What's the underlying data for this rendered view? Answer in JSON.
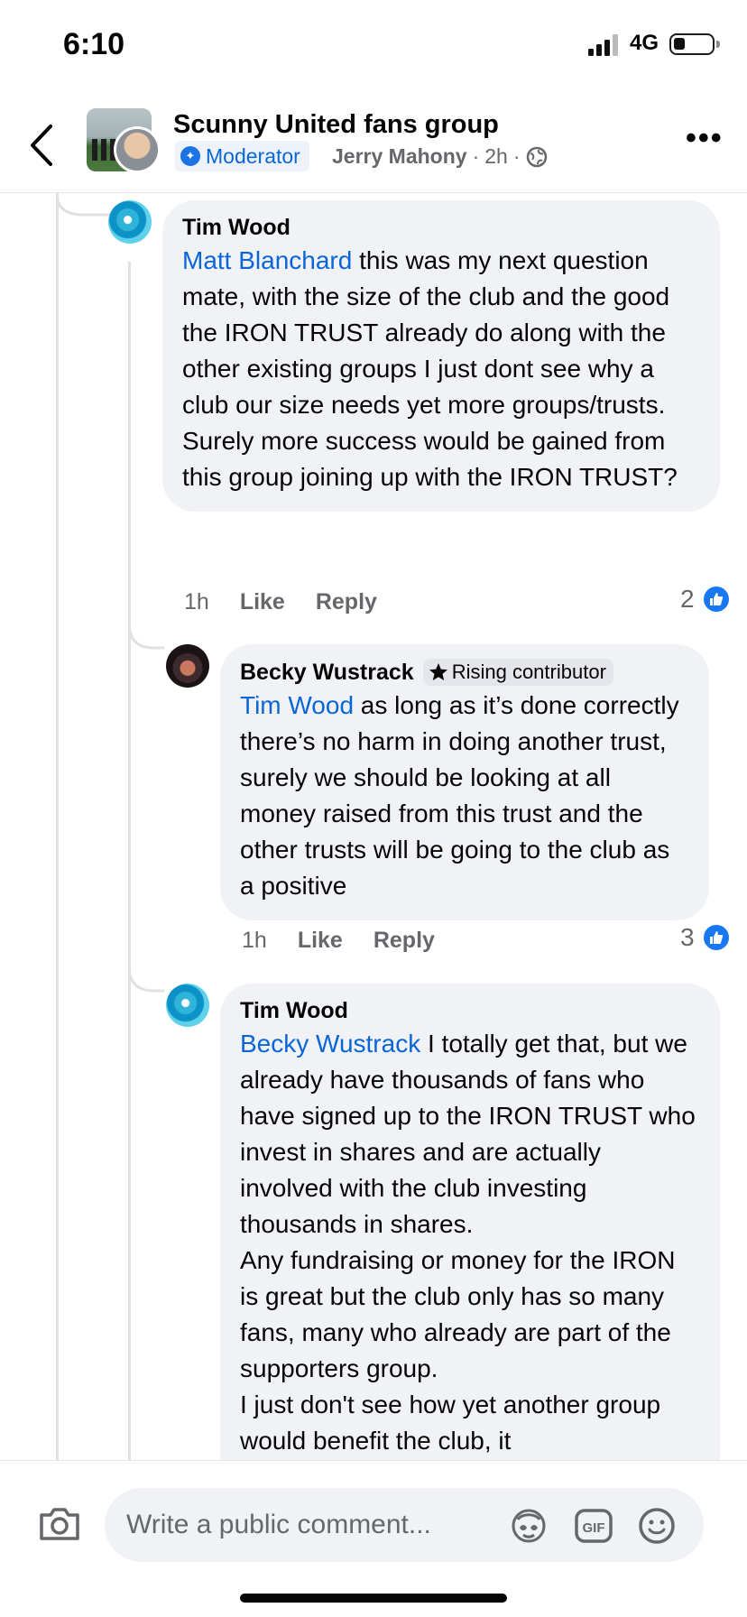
{
  "status_bar": {
    "time": "6:10",
    "network": "4G"
  },
  "header": {
    "group_name": "Scunny United fans group",
    "role_badge": "Moderator",
    "poster": "Jerry Mahony",
    "time": "2h",
    "separator": "·"
  },
  "comments": [
    {
      "author": "Tim Wood",
      "mention": "Matt Blanchard",
      "body": " this was my next question mate, with the size of the club and the good the IRON TRUST already do along with the other existing groups I just dont see why a club our size needs yet more groups/trusts.\nSurely more success would be gained from this group joining up with the IRON TRUST?",
      "time": "1h",
      "like_label": "Like",
      "reply_label": "Reply",
      "reaction_count": "2"
    },
    {
      "author": "Becky Wustrack",
      "badge": "Rising contributor",
      "mention": "Tim Wood",
      "body": " as long as it’s done correctly there’s no harm in doing another trust, surely we should be looking at all money raised from this trust and the other trusts will be going to the club as a positive",
      "time": "1h",
      "like_label": "Like",
      "reply_label": "Reply",
      "reaction_count": "3"
    },
    {
      "author": "Tim Wood",
      "mention": "Becky Wustrack",
      "body": " I totally get that, but we already have thousands of fans who have signed up to the IRON TRUST who invest in shares and are actually involved with the club investing thousands in shares.\nAny fundraising or money for the IRON is great but the club only has so many fans, many who already are part of the supporters group.\nI just don't see how yet another group would benefit the club, it"
    }
  ],
  "composer": {
    "placeholder": "Write a public comment..."
  },
  "icons": [
    "back-chevron-icon",
    "more-icon",
    "globe-icon",
    "camera-icon",
    "avatar-sticker-icon",
    "gif-icon",
    "emoji-icon",
    "like-reaction-icon",
    "star-icon",
    "moderator-icon"
  ],
  "colors": {
    "link": "#0a66d8",
    "bubble": "#f0f2f5",
    "like": "#1877f2",
    "muted": "#65676b"
  }
}
